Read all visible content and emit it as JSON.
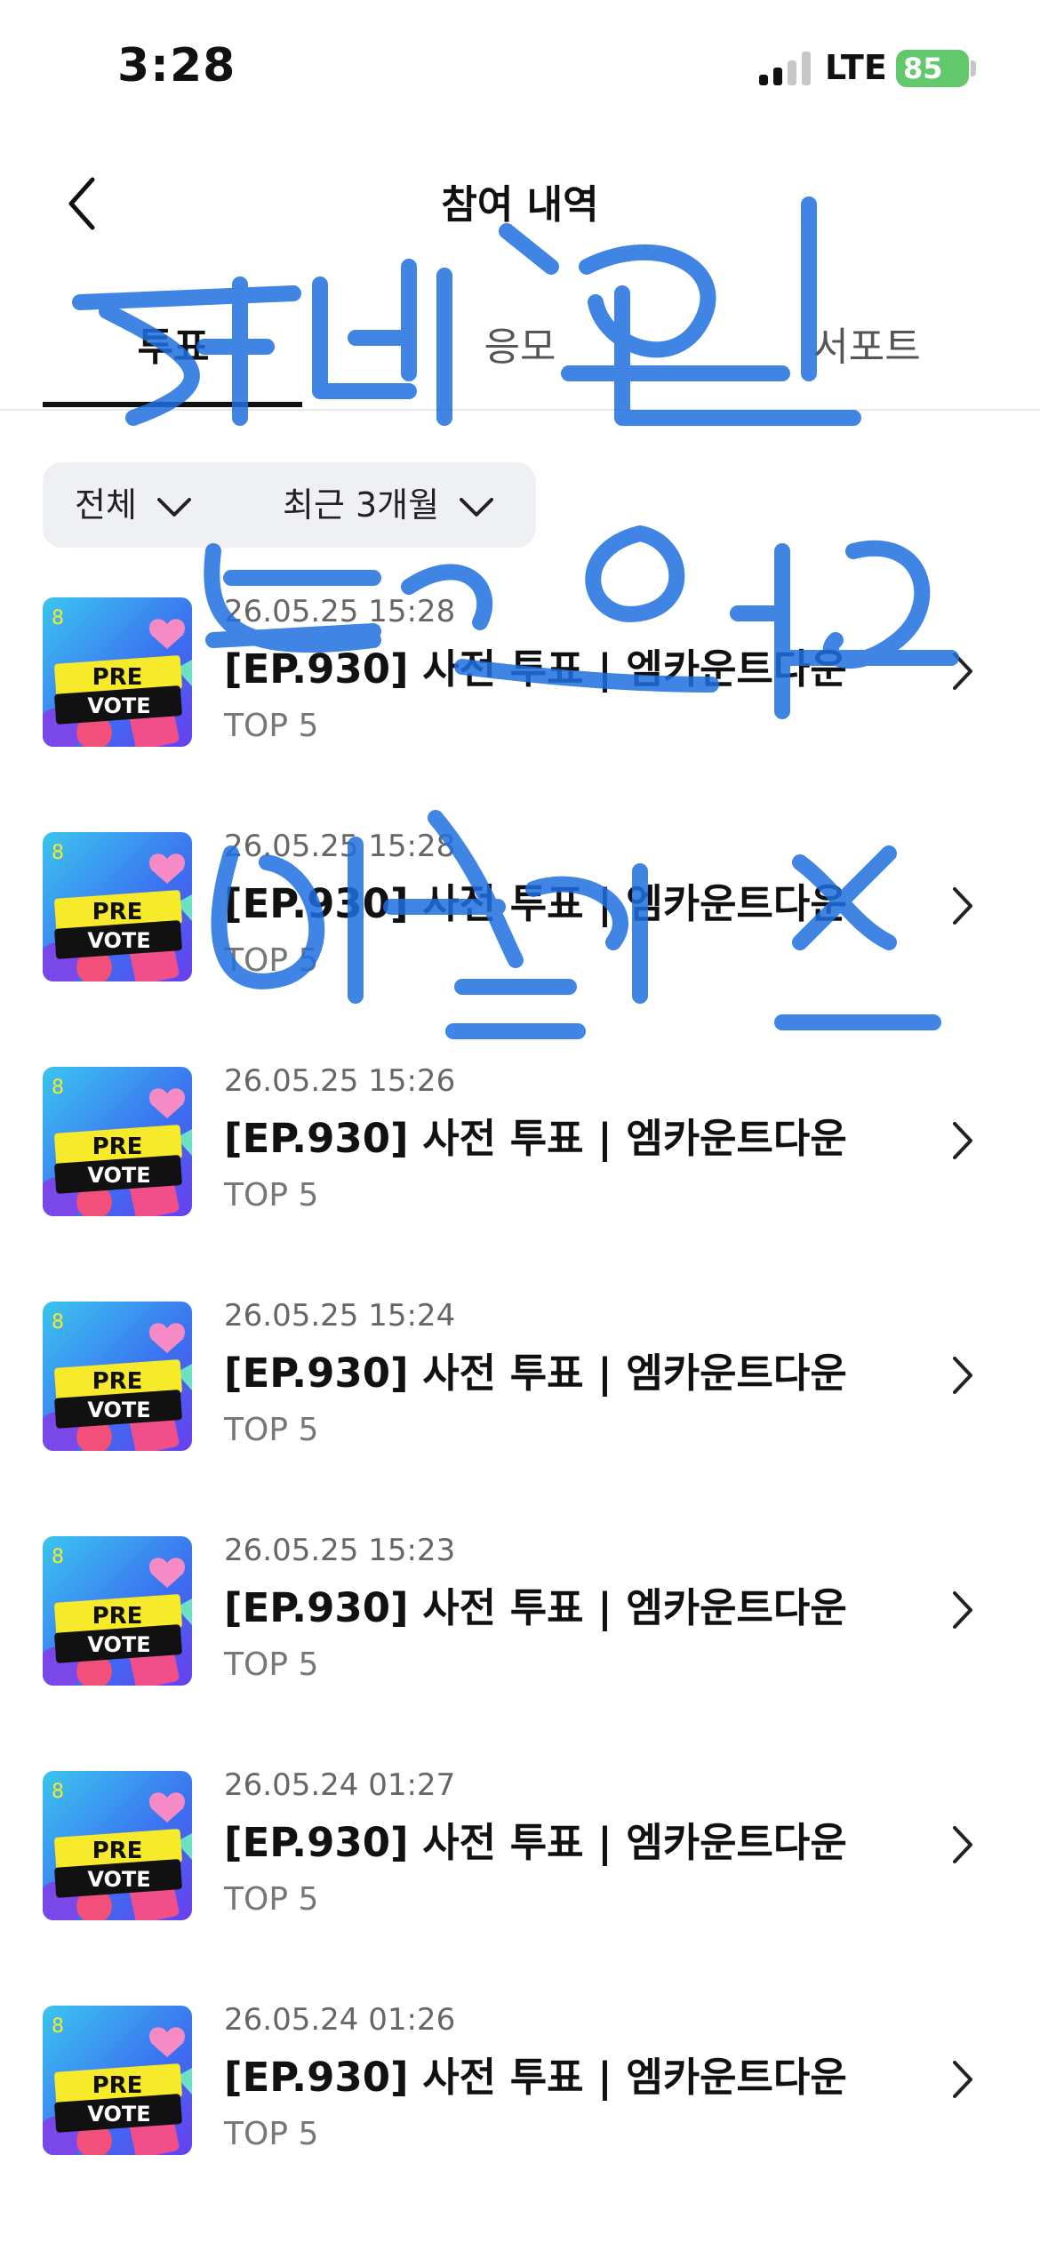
{
  "status": {
    "time": "3:28",
    "network": "LTE",
    "battery": "85"
  },
  "header": {
    "title": "참여 내역"
  },
  "tabs": [
    {
      "label": "투표",
      "active": true
    },
    {
      "label": "응모",
      "active": false
    },
    {
      "label": "서포트",
      "active": false
    }
  ],
  "filters": {
    "type": "전체",
    "period": "최근 3개월"
  },
  "thumbnail": {
    "line1": "PRE",
    "line2": "VOTE"
  },
  "items": [
    {
      "date": "26.05.25 15:28",
      "title": "[EP.930] 사전 투표 | 엠카운트다운",
      "subtitle": "TOP 5"
    },
    {
      "date": "26.05.25 15:28",
      "title": "[EP.930] 사전 투표 | 엠카운트다운",
      "subtitle": "TOP 5"
    },
    {
      "date": "26.05.25 15:26",
      "title": "[EP.930] 사전 투표 | 엠카운트다운",
      "subtitle": "TOP 5"
    },
    {
      "date": "26.05.25 15:24",
      "title": "[EP.930] 사전 투표 | 엠카운트다운",
      "subtitle": "TOP 5"
    },
    {
      "date": "26.05.25 15:23",
      "title": "[EP.930] 사전 투표 | 엠카운트다운",
      "subtitle": "TOP 5"
    },
    {
      "date": "26.05.24 01:27",
      "title": "[EP.930] 사전 투표 | 엠카운트다운",
      "subtitle": "TOP 5"
    },
    {
      "date": "26.05.24 01:26",
      "title": "[EP.930] 사전 투표 | 엠카운트다운",
      "subtitle": "TOP 5"
    }
  ],
  "handwritten_overlay": {
    "lines": [
      "제베원",
      "투표인증",
      "마결리스"
    ],
    "color": "#1f6fe0"
  },
  "colors": {
    "accent": "#111111",
    "filter_bg": "#eef0f3",
    "battery": "#63c86b"
  }
}
